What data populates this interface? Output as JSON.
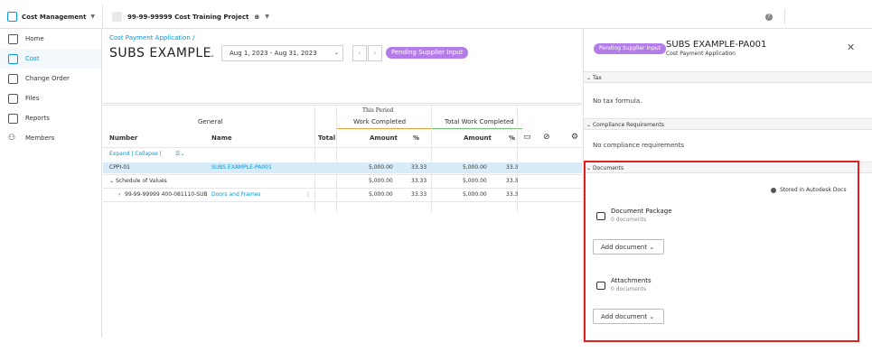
{
  "topbar": {
    "app_name": "Cost Management",
    "project_name": "99-99-99999 Cost Training Project"
  },
  "sidebar": {
    "items": [
      {
        "label": "Home"
      },
      {
        "label": "Cost"
      },
      {
        "label": "Change Order"
      },
      {
        "label": "Files"
      },
      {
        "label": "Reports"
      },
      {
        "label": "Members"
      }
    ]
  },
  "main": {
    "breadcrumb": "Cost Payment Application  /",
    "title": "SUBS EXAMPLE",
    "date_range": "Aug 1, 2023 - Aug 31, 2023",
    "status": "Pending Supplier Input",
    "grid": {
      "group_general": "General",
      "group_period_top": "This Period",
      "group_period": "Work Completed",
      "group_total": "Total Work Completed",
      "col_number": "Number",
      "col_name": "Name",
      "col_total": "Total",
      "col_amount": "Amount",
      "col_pct": "%",
      "col_amount2": "Amount",
      "col_pct2": "%",
      "expand_collapse": "Expand  |  Collapse  |",
      "rows": [
        {
          "number": "CPPI-01",
          "name": "SUBS EXAMPLE-PA001",
          "amount": "5,000.00",
          "pct": "33.33",
          "amount2": "5,000.00",
          "pct2": "33.3"
        },
        {
          "number": "Schedule of Values",
          "name": "",
          "amount": "5,000.00",
          "pct": "33.33",
          "amount2": "5,000.00",
          "pct2": "33.3"
        },
        {
          "number": "99-99-99999 400-081110-SUB",
          "name": "Doors and Frames",
          "amount": "5,000.00",
          "pct": "33.33",
          "amount2": "5,000.00",
          "pct2": "33.3"
        }
      ]
    }
  },
  "panel": {
    "status": "Pending Supplier Input",
    "title": "SUBS EXAMPLE-PA001",
    "subtitle": "Cost Payment Application",
    "tax_header": "Tax",
    "tax_text": "No tax formula.",
    "compliance_header": "Compliance Requirements",
    "compliance_text": "No compliance requirements",
    "documents_header": "Documents",
    "stored_note": "Stored in Autodesk Docs",
    "package_name": "Document Package",
    "package_count": "0 documents",
    "attach_name": "Attachments",
    "attach_count": "0 documents",
    "add_document": "Add document"
  },
  "colors": {
    "accent": "#0696d7",
    "status_pill": "#b47ce8",
    "highlight_border": "#e0201c"
  }
}
